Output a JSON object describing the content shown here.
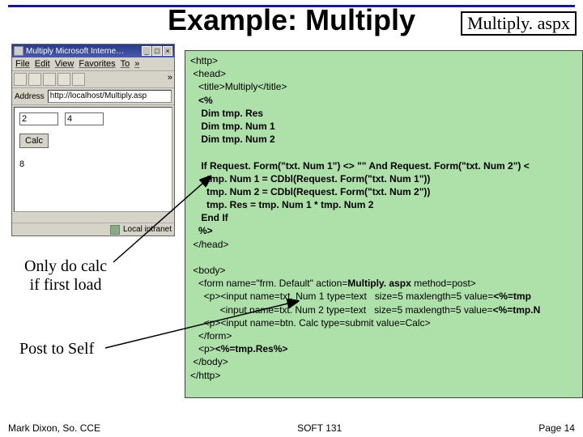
{
  "chart_data": null,
  "slide": {
    "title": "Example: Multiply",
    "filename_label": "Multiply. aspx"
  },
  "browser": {
    "window_title": "Multiply   Microsoft Interne…",
    "menus": {
      "file": "File",
      "edit": "Edit",
      "view": "View",
      "fav": "Favorites",
      "to": "To"
    },
    "chevron": "»",
    "address_label": "Address",
    "address_value": "http://localhost/Multiply.asp",
    "fields": {
      "num1": "2",
      "num2": "4"
    },
    "calc_label": "Calc",
    "result": "8",
    "status_text": "Local intranet"
  },
  "captions": {
    "calc": "Only do calc\nif first load",
    "post": "Post to Self"
  },
  "code": {
    "l1": "<http>",
    "l2": " <head>",
    "l3": "   <title>Multiply</title>",
    "l4": "   <%",
    "l5": "    Dim tmp. Res",
    "l6": "    Dim tmp. Num 1",
    "l7": "    Dim tmp. Num 2",
    "l8": "",
    "l9": "    If Request. Form(\"txt. Num 1\") <> \"\" And Request. Form(\"txt. Num 2\") <",
    "l10": "      tmp. Num 1 = CDbl(Request. Form(\"txt. Num 1\"))",
    "l11": "      tmp. Num 2 = CDbl(Request. Form(\"txt. Num 2\"))",
    "l12": "      tmp. Res = tmp. Num 1 * tmp. Num 2",
    "l13": "    End If",
    "l14": "   %>",
    "l15": " </head>",
    "l16": "",
    "l17": " <body>",
    "l18a": "   <form name=\"frm. Default\" action=",
    "l18b": "Multiply. aspx",
    "l18c": " method=post>",
    "l19a": "     <p><input name=txt. Num 1 type=text   size=5 maxlength=5 value=",
    "l19b": "<%=tmp",
    "l20a": "           <input name=txt. Num 2 type=text   size=5 maxlength=5 value=",
    "l20b": "<%=tmp.N",
    "l21": "     <p><input name=btn. Calc type=submit value=Calc>",
    "l22": "   </form>",
    "l23a": "   <p>",
    "l23b": "<%=tmp.Res%>",
    "l24": " </body>",
    "l25": "</http>"
  },
  "footer": {
    "left": "Mark Dixon, So. CCE",
    "center": "SOFT 131",
    "right": "Page 14"
  }
}
